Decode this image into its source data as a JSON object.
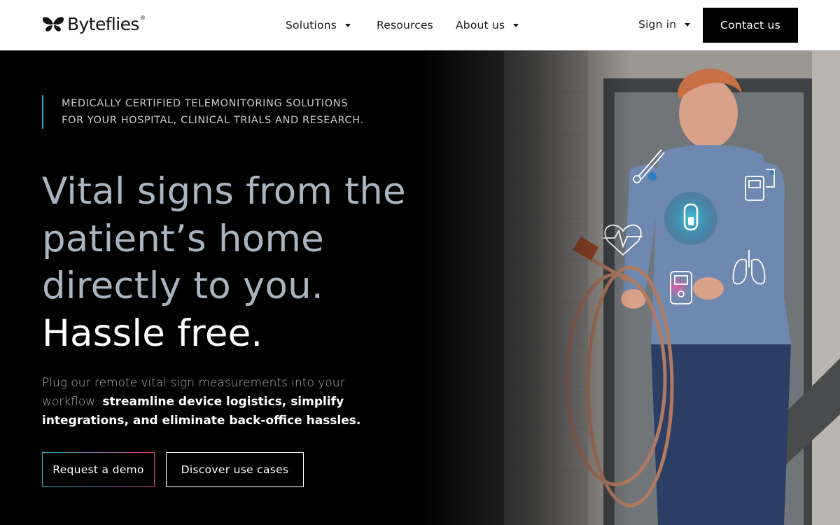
{
  "brand": {
    "name": "Byteflies",
    "registered_mark": "®",
    "logo_icon": "butterfly-icon"
  },
  "nav": {
    "items": [
      {
        "label": "Solutions",
        "has_dropdown": true
      },
      {
        "label": "Resources",
        "has_dropdown": false
      },
      {
        "label": "About us",
        "has_dropdown": true
      }
    ],
    "sign_in": "Sign in",
    "contact": "Contact us"
  },
  "hero": {
    "eyebrow": "MEDICALLY CERTIFIED TELEMONITORING SOLUTIONS FOR YOUR HOSPITAL, CLINICAL TRIALS AND RESEARCH.",
    "headline_lead": "Vital signs from the patient’s home directly to you.",
    "headline_emphasis": "Hassle free.",
    "lede_lead": "Plug our remote vital sign measurements into your workflow:",
    "lede_emphasis": "streamline device logistics, simplify integrations, and eliminate back-office hassles.",
    "primary_cta": "Request a demo",
    "secondary_cta": "Discover use cases",
    "overlay_icons": [
      "thermometer-icon",
      "heart-rate-icon",
      "wearable-sensor-icon",
      "glucose-meter-icon",
      "lungs-icon",
      "monitor-device-icon"
    ]
  },
  "colors": {
    "accent_blue": "#3aa7d9",
    "accent_pink": "#e0457f",
    "headline_gray": "#aab4c0",
    "background": "#000000"
  }
}
